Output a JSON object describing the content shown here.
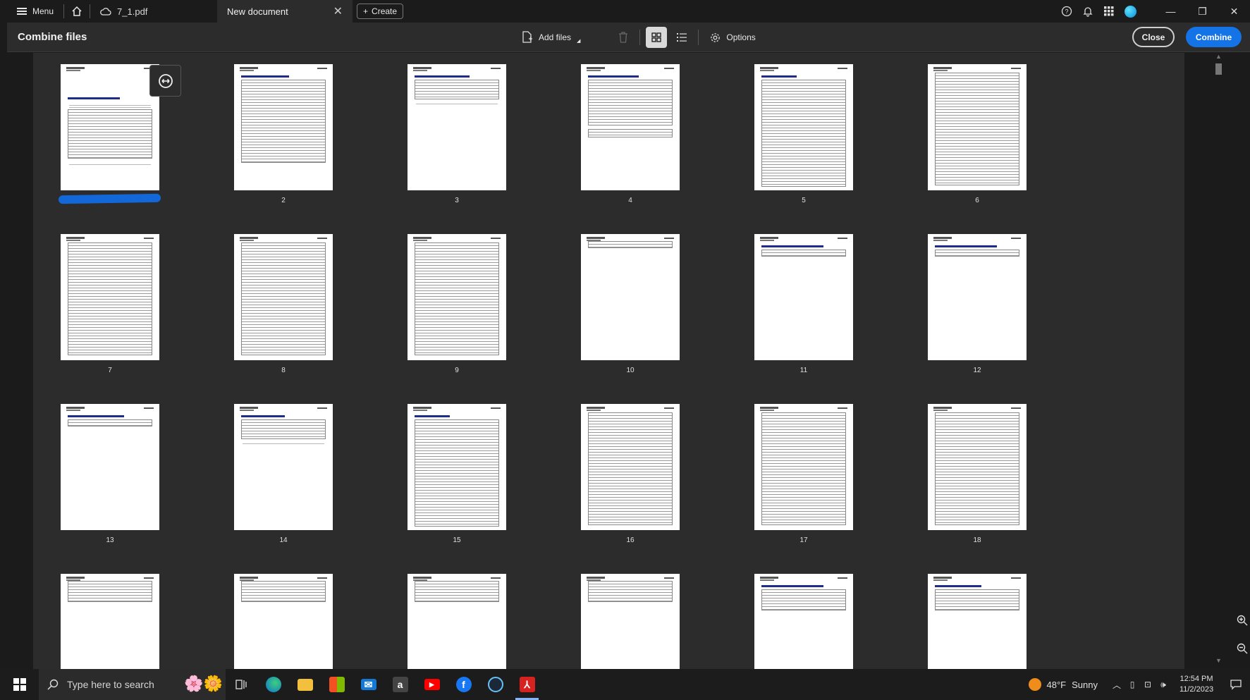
{
  "titlebar": {
    "menu_label": "Menu",
    "file_tab_label": "7_1.pdf",
    "active_tab_label": "New document",
    "create_label": "Create"
  },
  "toolbar": {
    "title": "Combine files",
    "add_files_label": "Add files",
    "options_label": "Options",
    "close_label": "Close",
    "combine_label": "Combine",
    "view_mode": "grid"
  },
  "pages": [
    {
      "label": "",
      "redacted_filename": true,
      "heading": "Personal Information Report",
      "layout": "cover"
    },
    {
      "label": "2",
      "heading": "Download Request Summary",
      "layout": "list"
    },
    {
      "label": "3",
      "heading": "My HealtheVet Account Summary",
      "layout": "short"
    },
    {
      "label": "4",
      "heading": "Self Reported Demographics",
      "layout": "form"
    },
    {
      "label": "5",
      "heading": "VA Demographics",
      "layout": "dense"
    },
    {
      "label": "6",
      "heading": "",
      "layout": "dense"
    },
    {
      "label": "7",
      "heading": "",
      "layout": "dense"
    },
    {
      "label": "8",
      "heading": "",
      "layout": "dense"
    },
    {
      "label": "9",
      "heading": "",
      "layout": "dense"
    },
    {
      "label": "10",
      "heading": "",
      "layout": "tiny"
    },
    {
      "label": "11",
      "heading": "Self Reported Healthcare Providers",
      "layout": "tiny"
    },
    {
      "label": "12",
      "heading": "Self Reported Treatment Facilities",
      "layout": "tiny"
    },
    {
      "label": "13",
      "heading": "Self Reported Health Insurance",
      "layout": "tiny"
    },
    {
      "label": "14",
      "heading": "VA Wellness Reminders",
      "layout": "short"
    },
    {
      "label": "15",
      "heading": "VA Appointments",
      "layout": "dense"
    },
    {
      "label": "16",
      "heading": "",
      "layout": "dense"
    },
    {
      "label": "17",
      "heading": "",
      "layout": "dense"
    },
    {
      "label": "18",
      "heading": "",
      "layout": "dense"
    },
    {
      "label": "",
      "heading": "",
      "layout": "partial"
    },
    {
      "label": "",
      "heading": "",
      "layout": "partial"
    },
    {
      "label": "",
      "heading": "",
      "layout": "partial"
    },
    {
      "label": "",
      "heading": "",
      "layout": "partial"
    },
    {
      "label": "",
      "heading": "VA Allergies and Adverse Reactions",
      "layout": "partial"
    },
    {
      "label": "",
      "heading": "Self Reported Allergies",
      "layout": "partial"
    }
  ],
  "taskbar": {
    "search_placeholder": "Type here to search",
    "weather_temp": "48°F",
    "weather_text": "Sunny",
    "time": "12:54 PM",
    "date": "11/2/2023"
  },
  "colors": {
    "accent": "#1473e6",
    "background": "#2c2c2c",
    "redaction": "#1268d8"
  }
}
